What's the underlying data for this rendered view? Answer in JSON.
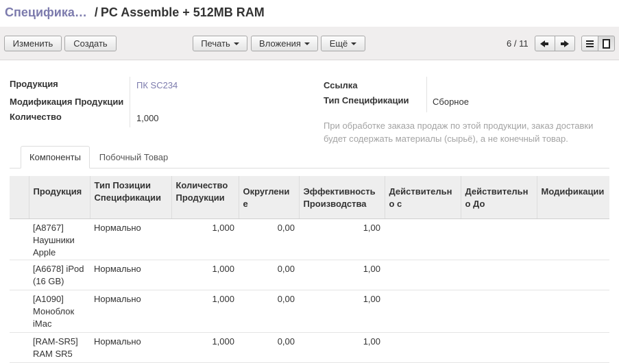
{
  "breadcrumb": {
    "parent": "Специфика…",
    "separator": "/",
    "current": "PC Assemble + 512MB RAM"
  },
  "toolbar": {
    "edit_label": "Изменить",
    "create_label": "Создать",
    "print_label": "Печать",
    "attachments_label": "Вложения",
    "more_label": "Ещё"
  },
  "pager": {
    "value": "6 / 11"
  },
  "form": {
    "product_label": "Продукция",
    "product_value": "ПК SC234",
    "variant_label": "Модификация Продукции",
    "variant_value": "",
    "quantity_label": "Количество",
    "quantity_value": "1,000",
    "reference_label": "Ссылка",
    "reference_value": "",
    "type_label": "Тип Спецификации",
    "type_value": "Сборное",
    "help_text": "При обработке заказа продаж по этой продукции, заказ доставки будет содержать материалы (сырьё), а не конечный товар."
  },
  "tabs": [
    {
      "label": "Компоненты",
      "active": true
    },
    {
      "label": "Побочный Товар",
      "active": false
    }
  ],
  "table": {
    "columns": [
      "Продукция",
      "Тип Позиции Спецификации",
      "Количество Продукции",
      "Округление",
      "Эффективность Производства",
      "Действительно с",
      "Действительно До",
      "Модификации"
    ],
    "rows": [
      {
        "product": "[A8767] Наушники Apple",
        "type": "Нормально",
        "qty": "1,000",
        "rounding": "0,00",
        "efficiency": "1,00",
        "valid_from": "",
        "valid_to": "",
        "variants": ""
      },
      {
        "product": "[A6678] iPod (16 GB)",
        "type": "Нормально",
        "qty": "1,000",
        "rounding": "0,00",
        "efficiency": "1,00",
        "valid_from": "",
        "valid_to": "",
        "variants": ""
      },
      {
        "product": "[A1090] Моноблок iMac",
        "type": "Нормально",
        "qty": "1,000",
        "rounding": "0,00",
        "efficiency": "1,00",
        "valid_from": "",
        "valid_to": "",
        "variants": ""
      },
      {
        "product": "[RAM-SR5] RAM SR5",
        "type": "Нормально",
        "qty": "1,000",
        "rounding": "0,00",
        "efficiency": "1,00",
        "valid_from": "",
        "valid_to": "",
        "variants": ""
      }
    ]
  },
  "icons": {
    "prev": "arrow-left-icon",
    "next": "arrow-right-icon",
    "list_view": "list-view-icon",
    "form_view": "form-view-icon",
    "dropdown": "caret-down-icon"
  }
}
